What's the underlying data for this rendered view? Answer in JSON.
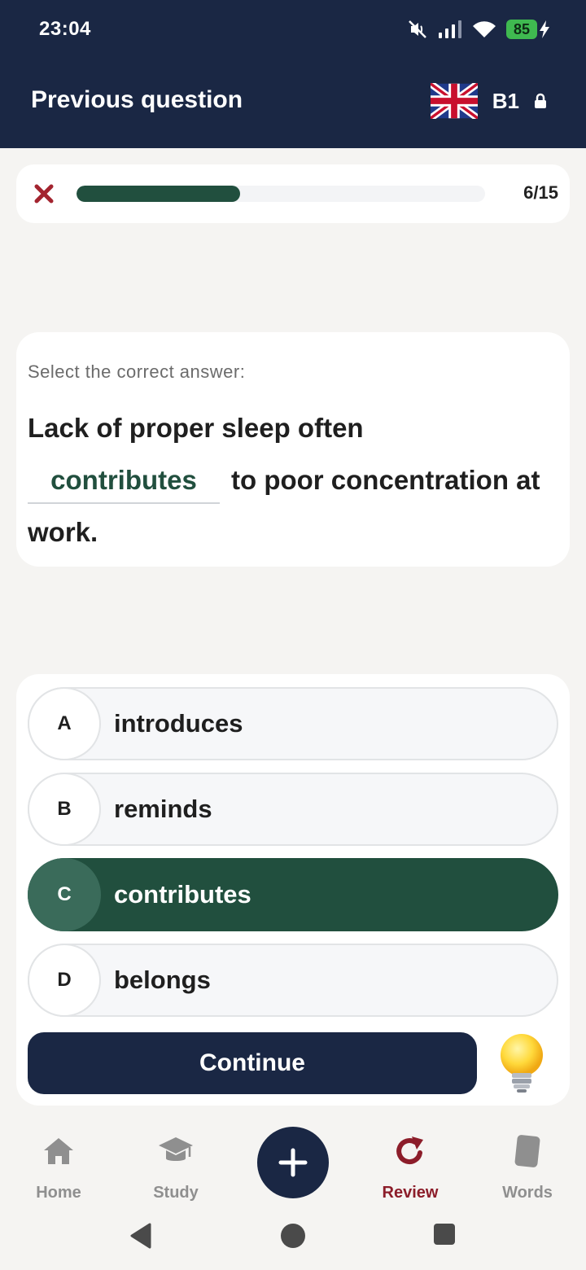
{
  "status_bar": {
    "time": "23:04",
    "battery": "85",
    "icons": [
      "mute-icon",
      "signal-icon",
      "wifi-icon",
      "battery-icon",
      "charging-icon"
    ]
  },
  "header": {
    "title": "Previous question",
    "flag_icon": "uk-flag-icon",
    "level": "B1",
    "lock_icon": "lock-icon"
  },
  "progress": {
    "current": 6,
    "total": 15,
    "label": "6/15",
    "fill_fraction": 0.4
  },
  "question": {
    "instruction": "Select the correct answer:",
    "sentence_before": "Lack of proper sleep often",
    "blank_answer": "contributes",
    "sentence_after": "to poor concentration at work."
  },
  "options": [
    {
      "letter": "A",
      "text": "introduces",
      "selected": false
    },
    {
      "letter": "B",
      "text": "reminds",
      "selected": false
    },
    {
      "letter": "C",
      "text": "contributes",
      "selected": true
    },
    {
      "letter": "D",
      "text": "belongs",
      "selected": false
    }
  ],
  "actions": {
    "continue_label": "Continue",
    "hint_icon": "lightbulb-icon"
  },
  "bottom_nav": {
    "items": [
      {
        "label": "Home",
        "icon": "home-icon",
        "active": false
      },
      {
        "label": "Study",
        "icon": "graduation-cap-icon",
        "active": false
      },
      {
        "label": "Review",
        "icon": "refresh-icon",
        "active": true
      },
      {
        "label": "Words",
        "icon": "card-icon",
        "active": false
      }
    ],
    "fab_icon": "plus-icon"
  },
  "colors": {
    "header_bg": "#1a2744",
    "accent_green": "#214f3e",
    "active_nav": "#8c1d2a",
    "background": "#f5f4f2"
  }
}
